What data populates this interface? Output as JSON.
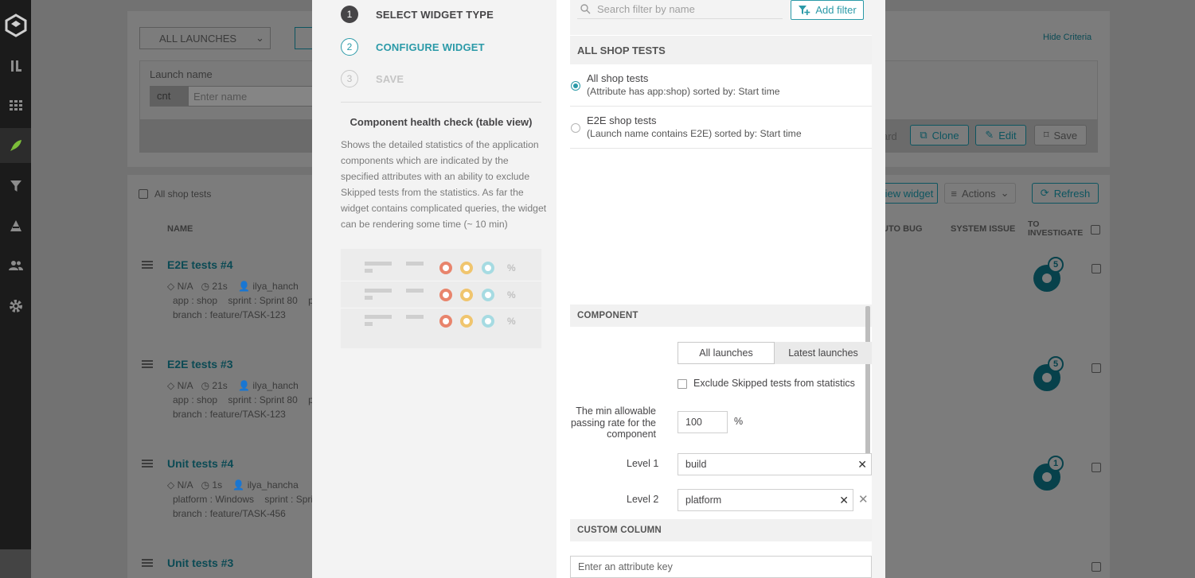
{
  "sidebar": {
    "icons": [
      "logo-icon",
      "launches-icon",
      "dashboard-icon",
      "rocket-icon",
      "filter-icon",
      "debug-icon",
      "members-icon",
      "settings-icon"
    ]
  },
  "background": {
    "launch_selector": "ALL LAUNCHES",
    "hide_criteria": "Hide Criteria",
    "launch_name_label": "Launch name",
    "cnt_value": "cnt",
    "name_placeholder": "Enter name",
    "filter_name": "All shop tests",
    "buttons": {
      "discard": "ard",
      "clone": "Clone",
      "edit": "Edit",
      "save": "Save",
      "add_widget": "iew widget",
      "actions": "Actions",
      "refresh": "Refresh"
    },
    "columns": {
      "name": "NAME",
      "auto_bug": "UTO BUG",
      "system_issue": "SYSTEM ISSUE",
      "to_investigate_1": "TO",
      "to_investigate_2": "INVESTIGATE"
    },
    "launches": [
      {
        "title": "E2E tests #4",
        "na": "N/A",
        "duration": "21s",
        "user": "ilya_hanch",
        "attr1": "app : shop",
        "attr2": "sprint : Sprint 80",
        "attr3": "p",
        "branch": "branch : feature/TASK-123",
        "count": "5"
      },
      {
        "title": "E2E tests #3",
        "na": "N/A",
        "duration": "21s",
        "user": "ilya_hanch",
        "attr1": "app : shop",
        "attr2": "sprint : Sprint 80",
        "attr3": "p",
        "branch": "branch : feature/TASK-123",
        "count": "5"
      },
      {
        "title": "Unit tests #4",
        "na": "N/A",
        "duration": "1s",
        "user": "ilya_hancha",
        "attr1": "platform : Windows",
        "attr2": "sprint : Spri",
        "attr3": "",
        "branch": "branch : feature/TASK-456",
        "count": "1"
      },
      {
        "title": "Unit tests #3"
      }
    ]
  },
  "wizard": {
    "steps": [
      {
        "num": "1",
        "label": "SELECT WIDGET TYPE"
      },
      {
        "num": "2",
        "label": "CONFIGURE WIDGET"
      },
      {
        "num": "3",
        "label": "SAVE"
      }
    ],
    "widget_title": "Component health check (table view)",
    "widget_desc": "Shows the detailed statistics of the application components which are indicated by the specified attributes with an ability to exclude Skipped tests from the statistics. As far the widget contains complicated queries, the widget can be rendering some time (~ 10 min)",
    "preview_pct": "%",
    "search_placeholder": "Search filter by name",
    "add_filter": "Add filter",
    "filters_header": "ALL SHOP TESTS",
    "filters": [
      {
        "title": "All shop tests",
        "sub": "(Attribute has app:shop) sorted by: Start time",
        "selected": true
      },
      {
        "title": "E2E shop tests",
        "sub": "(Launch name contains E2E) sorted by: Start time",
        "selected": false
      }
    ],
    "component_header": "COMPONENT",
    "toggle": {
      "all": "All launches",
      "latest": "Latest launches"
    },
    "exclude_skipped": "Exclude Skipped tests from statistics",
    "min_rate_label": "The min allowable passing rate for the component",
    "min_rate_value": "100",
    "min_rate_unit": "%",
    "level1_label": "Level 1",
    "level1_value": "build",
    "level2_label": "Level 2",
    "level2_value": "platform",
    "custom_column_header": "CUSTOM COLUMN",
    "attr_key_placeholder": "Enter an attribute key"
  }
}
